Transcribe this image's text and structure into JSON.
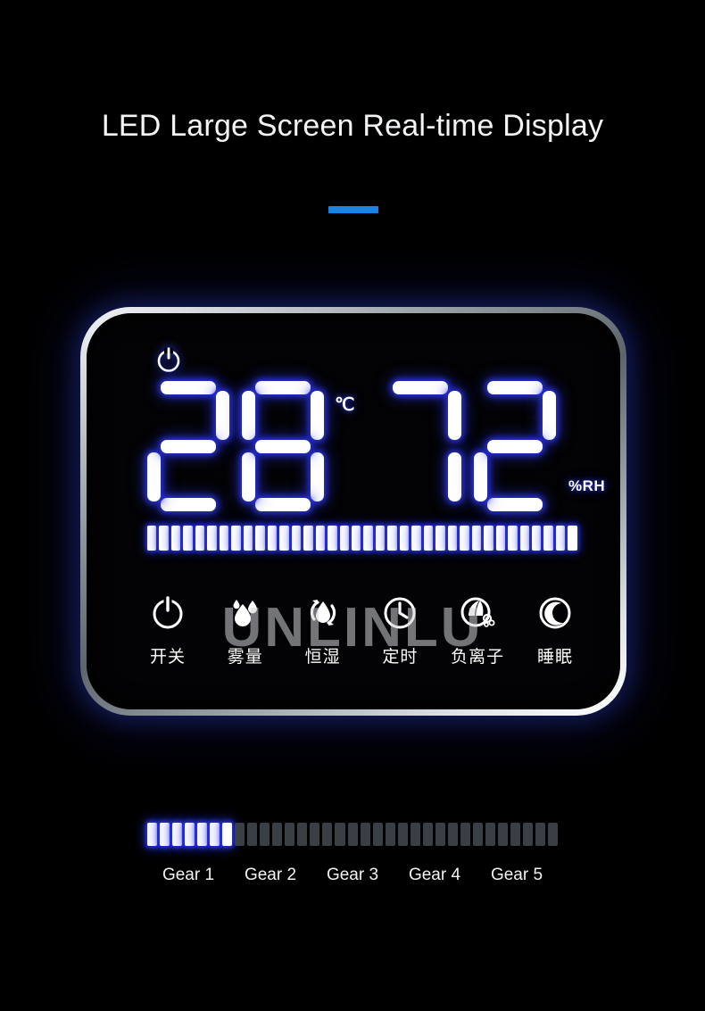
{
  "heading": {
    "title": "LED Large Screen Real-time Display",
    "accent_color": "#1784e8"
  },
  "watermark": {
    "text": "UNLINLU"
  },
  "device": {
    "power_indicator_icon": "power-icon",
    "readout": {
      "temperature": {
        "value": "28",
        "digits": [
          "2",
          "8"
        ],
        "unit": "℃"
      },
      "humidity": {
        "value": "72",
        "digits": [
          "7",
          "2"
        ],
        "unit": "%RH"
      }
    },
    "level_bar": {
      "total_segments": 36,
      "lit_segments": 36
    },
    "controls": [
      {
        "label": "开关",
        "icon": "power-icon",
        "meaning": "power"
      },
      {
        "label": "雾量",
        "icon": "mist-icon",
        "meaning": "mist-volume"
      },
      {
        "label": "恒湿",
        "icon": "humidity-icon",
        "meaning": "constant-humidity"
      },
      {
        "label": "定时",
        "icon": "timer-icon",
        "meaning": "timer"
      },
      {
        "label": "负离子",
        "icon": "ion-icon",
        "meaning": "negative-ion"
      },
      {
        "label": "睡眠",
        "icon": "moon-icon",
        "meaning": "sleep"
      }
    ]
  },
  "gear_selector": {
    "total_segments": 33,
    "lit_segments": 7,
    "labels": [
      "Gear 1",
      "Gear 2",
      "Gear 3",
      "Gear 4",
      "Gear 5"
    ],
    "selected": "Gear 1",
    "lit_color": "#ffffff",
    "unlit_color": "#3a3f46"
  }
}
